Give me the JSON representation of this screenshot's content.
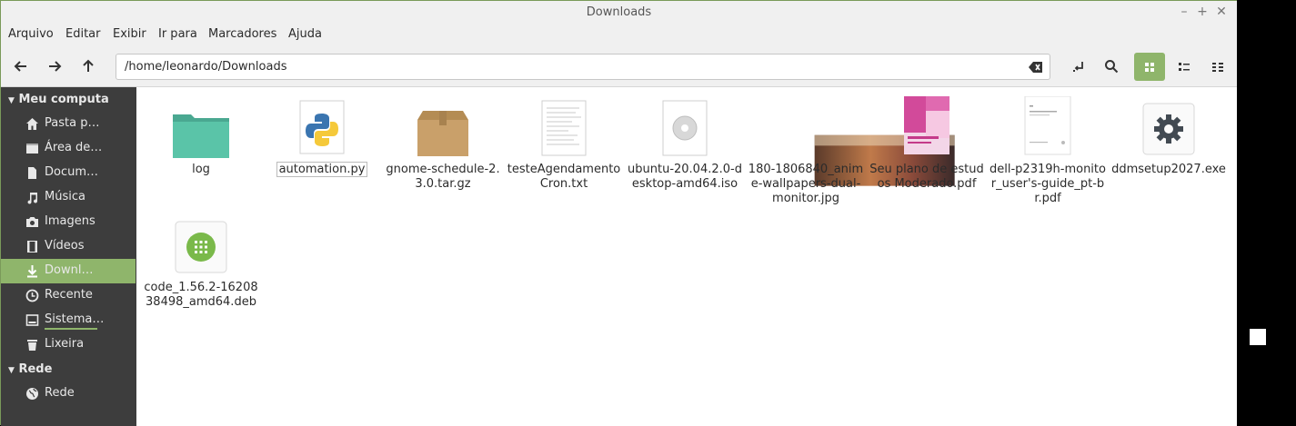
{
  "window": {
    "title": "Downloads"
  },
  "menubar": [
    "Arquivo",
    "Editar",
    "Exibir",
    "Ir para",
    "Marcadores",
    "Ajuda"
  ],
  "toolbar": {
    "path": "/home/leonardo/Downloads"
  },
  "sidebar": {
    "section1": "Meu computa",
    "items": [
      {
        "label": "Pasta p…",
        "icon": "home-icon"
      },
      {
        "label": "Área de…",
        "icon": "desktop-icon"
      },
      {
        "label": "Docum…",
        "icon": "document-icon"
      },
      {
        "label": "Música",
        "icon": "music-icon"
      },
      {
        "label": "Imagens",
        "icon": "camera-icon"
      },
      {
        "label": "Vídeos",
        "icon": "film-icon"
      },
      {
        "label": "Downl…",
        "icon": "download-icon"
      },
      {
        "label": "Recente",
        "icon": "clock-icon"
      },
      {
        "label": "Sistema…",
        "icon": "drive-icon"
      },
      {
        "label": "Lixeira",
        "icon": "trash-icon"
      }
    ],
    "section2": "Rede",
    "network": [
      {
        "label": "Rede",
        "icon": "globe-icon"
      }
    ]
  },
  "files": [
    {
      "name": "log",
      "type": "folder"
    },
    {
      "name": "automation.py",
      "type": "python"
    },
    {
      "name": "gnome-schedule-2.3.0.tar.gz",
      "type": "archive"
    },
    {
      "name": "testeAgendamentoCron.txt",
      "type": "text"
    },
    {
      "name": "ubuntu-20.04.2.0-desktop-amd64.iso",
      "type": "disc"
    },
    {
      "name": "180-1806840_anime-wallpapers-dual-monitor.jpg",
      "type": "image"
    },
    {
      "name": "Seu plano de estudos Moderado.pdf",
      "type": "pdf-pink"
    },
    {
      "name": "dell-p2319h-monitor_user's-guide_pt-br.pdf",
      "type": "pdf-white"
    },
    {
      "name": "ddmsetup2027.exe",
      "type": "exe"
    },
    {
      "name": "code_1.56.2-1620838498_amd64.deb",
      "type": "deb"
    }
  ],
  "colors": {
    "accent": "#8fb56b",
    "sidebar": "#3d3d3d",
    "folder": "#5ac4a8"
  }
}
